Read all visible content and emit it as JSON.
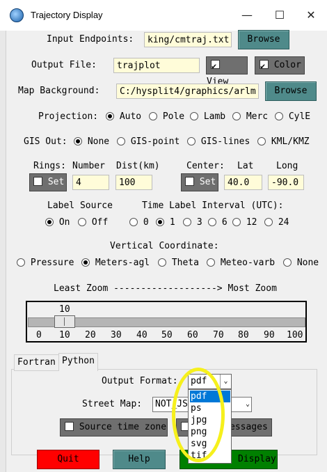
{
  "window": {
    "title": "Trajectory Display",
    "minimize": "—",
    "maximize": "☐",
    "close": "✕"
  },
  "input": {
    "label": "Input Endpoints:",
    "value": "king/cmtraj.txt",
    "browse": "Browse"
  },
  "output": {
    "label": "Output File:",
    "value": "trajplot",
    "view_label": "View",
    "view_checked": true,
    "color_label": "Color",
    "color_checked": true
  },
  "map": {
    "label": "Map Background:",
    "value": "C:/hysplit4/graphics/arlm",
    "browse": "Browse"
  },
  "projection": {
    "label": "Projection:",
    "options": [
      "Auto",
      "Pole",
      "Lamb",
      "Merc",
      "CylE"
    ],
    "selected": "Auto"
  },
  "gis": {
    "label": "GIS Out:",
    "options": [
      "None",
      "GIS-point",
      "GIS-lines",
      "KML/KMZ"
    ],
    "selected": "None"
  },
  "rings": {
    "label": "Rings:",
    "number_label": "Number",
    "dist_label": "Dist(km)",
    "set_label": "Set",
    "number": "4",
    "dist": "100"
  },
  "center": {
    "label": "Center:",
    "lat_label": "Lat",
    "long_label": "Long",
    "set_label": "Set",
    "lat": "40.0",
    "long": "-90.0"
  },
  "label_source": {
    "label": "Label Source",
    "options": [
      "On",
      "Off"
    ],
    "selected": "On"
  },
  "time_label": {
    "label": "Time Label Interval (UTC):",
    "options": [
      "0",
      "1",
      "3",
      "6",
      "12",
      "24"
    ],
    "selected": "1"
  },
  "vertical": {
    "label": "Vertical Coordinate:",
    "options": [
      "Pressure",
      "Meters-agl",
      "Theta",
      "Meteo-varb",
      "None"
    ],
    "selected": "Meters-agl"
  },
  "zoom": {
    "label": "Least Zoom -------------------> Most Zoom",
    "value": "10",
    "ticks": [
      "0",
      "10",
      "20",
      "30",
      "40",
      "50",
      "60",
      "70",
      "80",
      "90",
      "100"
    ]
  },
  "tabs": {
    "fortran": "Fortran",
    "python": "Python"
  },
  "python": {
    "format_label": "Output Format:",
    "format_value": "pdf",
    "formats": [
      "pdf",
      "ps",
      "jpg",
      "png",
      "svg",
      "tif"
    ],
    "street_label": "Street Map:",
    "street_value": "NOT_JS",
    "source_tz": "Source time zone",
    "messages": "essages"
  },
  "buttons": {
    "quit": "Quit",
    "help": "Help",
    "display": "Display"
  },
  "colors": {
    "quit": "#ff0000",
    "help": "#4f8a8a",
    "display": "#008000",
    "highlight": "#f6f01c",
    "field": "#fffcd9"
  }
}
